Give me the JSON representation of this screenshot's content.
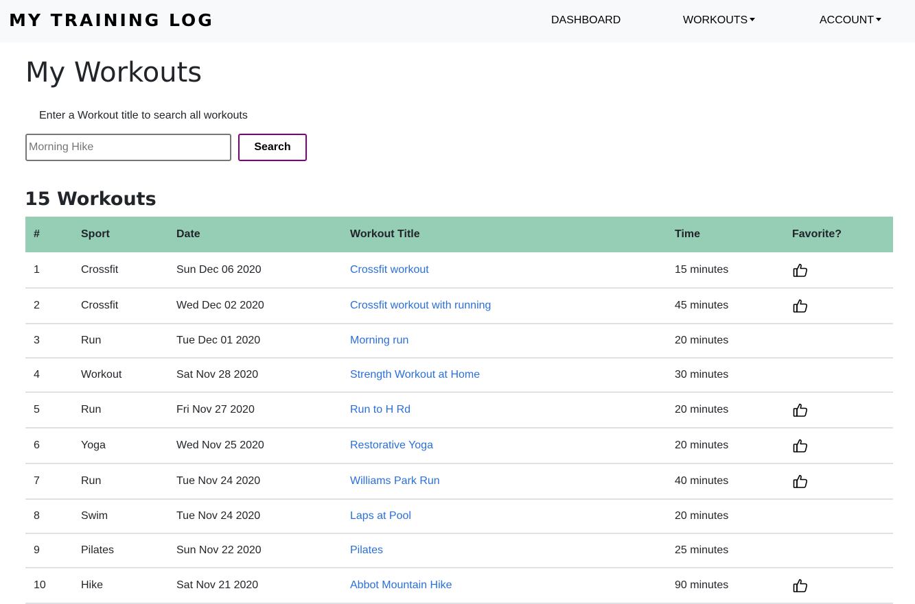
{
  "navbar": {
    "brand": "MY TRAINING LOG",
    "links": [
      {
        "label": "DASHBOARD",
        "has_dropdown": false
      },
      {
        "label": "WORKOUTS",
        "has_dropdown": true
      },
      {
        "label": "ACCOUNT",
        "has_dropdown": true
      }
    ]
  },
  "page_title": "My Workouts",
  "search": {
    "label": "Enter a Workout title to search all workouts",
    "placeholder": "Morning Hike",
    "value": "",
    "button_label": "Search"
  },
  "workouts_count": "15 Workouts",
  "colors": {
    "header_bg": "#95cdb5",
    "link": "#2a6fdb",
    "search_border": "#800080",
    "navbar_bg": "#f8f9fa"
  },
  "table": {
    "columns": [
      "#",
      "Sport",
      "Date",
      "Workout Title",
      "Time",
      "Favorite?"
    ],
    "rows": [
      {
        "num": "1",
        "sport": "Crossfit",
        "date": "Sun Dec 06 2020",
        "title": "Crossfit workout",
        "time": "15 minutes",
        "favorite": true
      },
      {
        "num": "2",
        "sport": "Crossfit",
        "date": "Wed Dec 02 2020",
        "title": "Crossfit workout with running",
        "time": "45 minutes",
        "favorite": true
      },
      {
        "num": "3",
        "sport": "Run",
        "date": "Tue Dec 01 2020",
        "title": "Morning run",
        "time": "20 minutes",
        "favorite": false
      },
      {
        "num": "4",
        "sport": "Workout",
        "date": "Sat Nov 28 2020",
        "title": "Strength Workout at Home",
        "time": "30 minutes",
        "favorite": false
      },
      {
        "num": "5",
        "sport": "Run",
        "date": "Fri Nov 27 2020",
        "title": "Run to H Rd",
        "time": "20 minutes",
        "favorite": true
      },
      {
        "num": "6",
        "sport": "Yoga",
        "date": "Wed Nov 25 2020",
        "title": "Restorative Yoga",
        "time": "20 minutes",
        "favorite": true
      },
      {
        "num": "7",
        "sport": "Run",
        "date": "Tue Nov 24 2020",
        "title": "Williams Park Run",
        "time": "40 minutes",
        "favorite": true
      },
      {
        "num": "8",
        "sport": "Swim",
        "date": "Tue Nov 24 2020",
        "title": "Laps at Pool",
        "time": "20 minutes",
        "favorite": false
      },
      {
        "num": "9",
        "sport": "Pilates",
        "date": "Sun Nov 22 2020",
        "title": "Pilates",
        "time": "25 minutes",
        "favorite": false
      },
      {
        "num": "10",
        "sport": "Hike",
        "date": "Sat Nov 21 2020",
        "title": "Abbot Mountain Hike",
        "time": "90 minutes",
        "favorite": true
      }
    ],
    "favorite_icon": "thumbs-up-icon"
  }
}
